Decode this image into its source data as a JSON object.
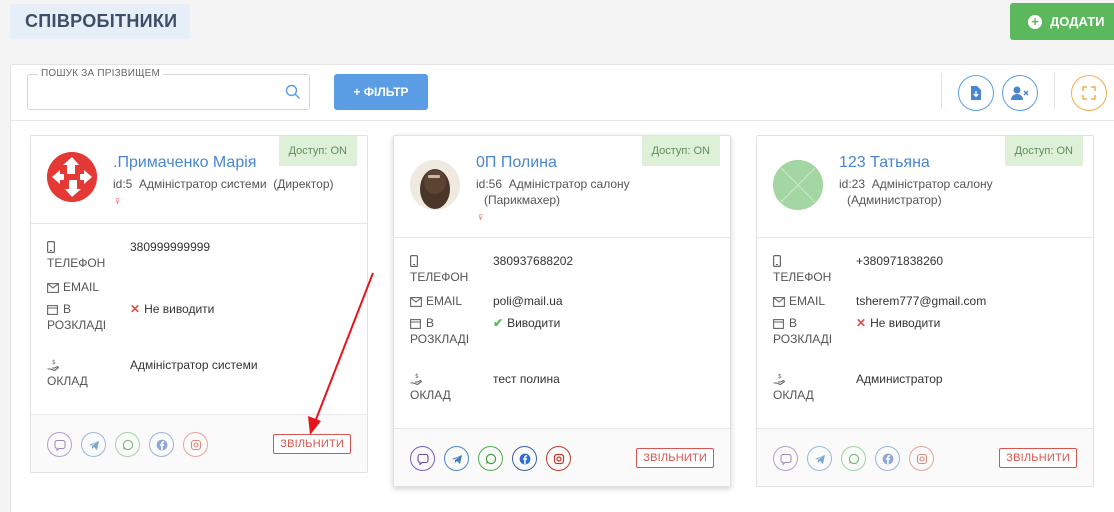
{
  "header": {
    "title": "СПІВРОБІТНИКИ",
    "add_label": "ДОДАТИ"
  },
  "toolbar": {
    "search_label": "ПОШУК ЗА ПРІЗВИЩЕМ",
    "search_value": "",
    "filter_label": "+ ФІЛЬТР",
    "icons": [
      "file-download-icon",
      "user-remove-icon",
      "fullscreen-icon"
    ]
  },
  "labels": {
    "phone": "ТЕЛЕФОН",
    "email": "EMAIL",
    "schedule": "В РОЗКЛАДІ",
    "salary": "ОКЛАД",
    "fire": "ЗВІЛЬНИТИ",
    "gender_symbol": "♀"
  },
  "employees": [
    {
      "access": "Доступ: ON",
      "name": ".Примаченко Марія",
      "id_text": "id:5",
      "role": "Адміністратор системи",
      "role_sub": "(Директор)",
      "phone": "380999999999",
      "email": "",
      "schedule": "Не виводити",
      "salary": "Адміністратор системи"
    },
    {
      "access": "Доступ: ON",
      "name": "0П Полина",
      "id_text": "id:56",
      "role": "Адміністратор салону",
      "role_sub": "(Парикмахер)",
      "phone": "380937688202",
      "email": "poli@mail.ua",
      "schedule": "Виводити",
      "salary": "тест полина"
    },
    {
      "access": "Доступ: ON",
      "name": "123 Татьяна",
      "id_text": "id:23",
      "role": "Адміністратор салону",
      "role_sub": "(Администратор)",
      "phone": "+380971838260",
      "email": "tsherem777@gmail.com",
      "schedule": "Не виводити",
      "salary": "Администратор"
    }
  ],
  "colors": {
    "accent_blue": "#5b9de5",
    "add_green": "#5cb85c",
    "danger_red": "#d9534f",
    "check_green": "#5cb85c",
    "access_badge": "#dff0d8"
  },
  "socials": [
    "viber-icon",
    "telegram-icon",
    "whatsapp-icon",
    "facebook-icon",
    "instagram-icon"
  ]
}
